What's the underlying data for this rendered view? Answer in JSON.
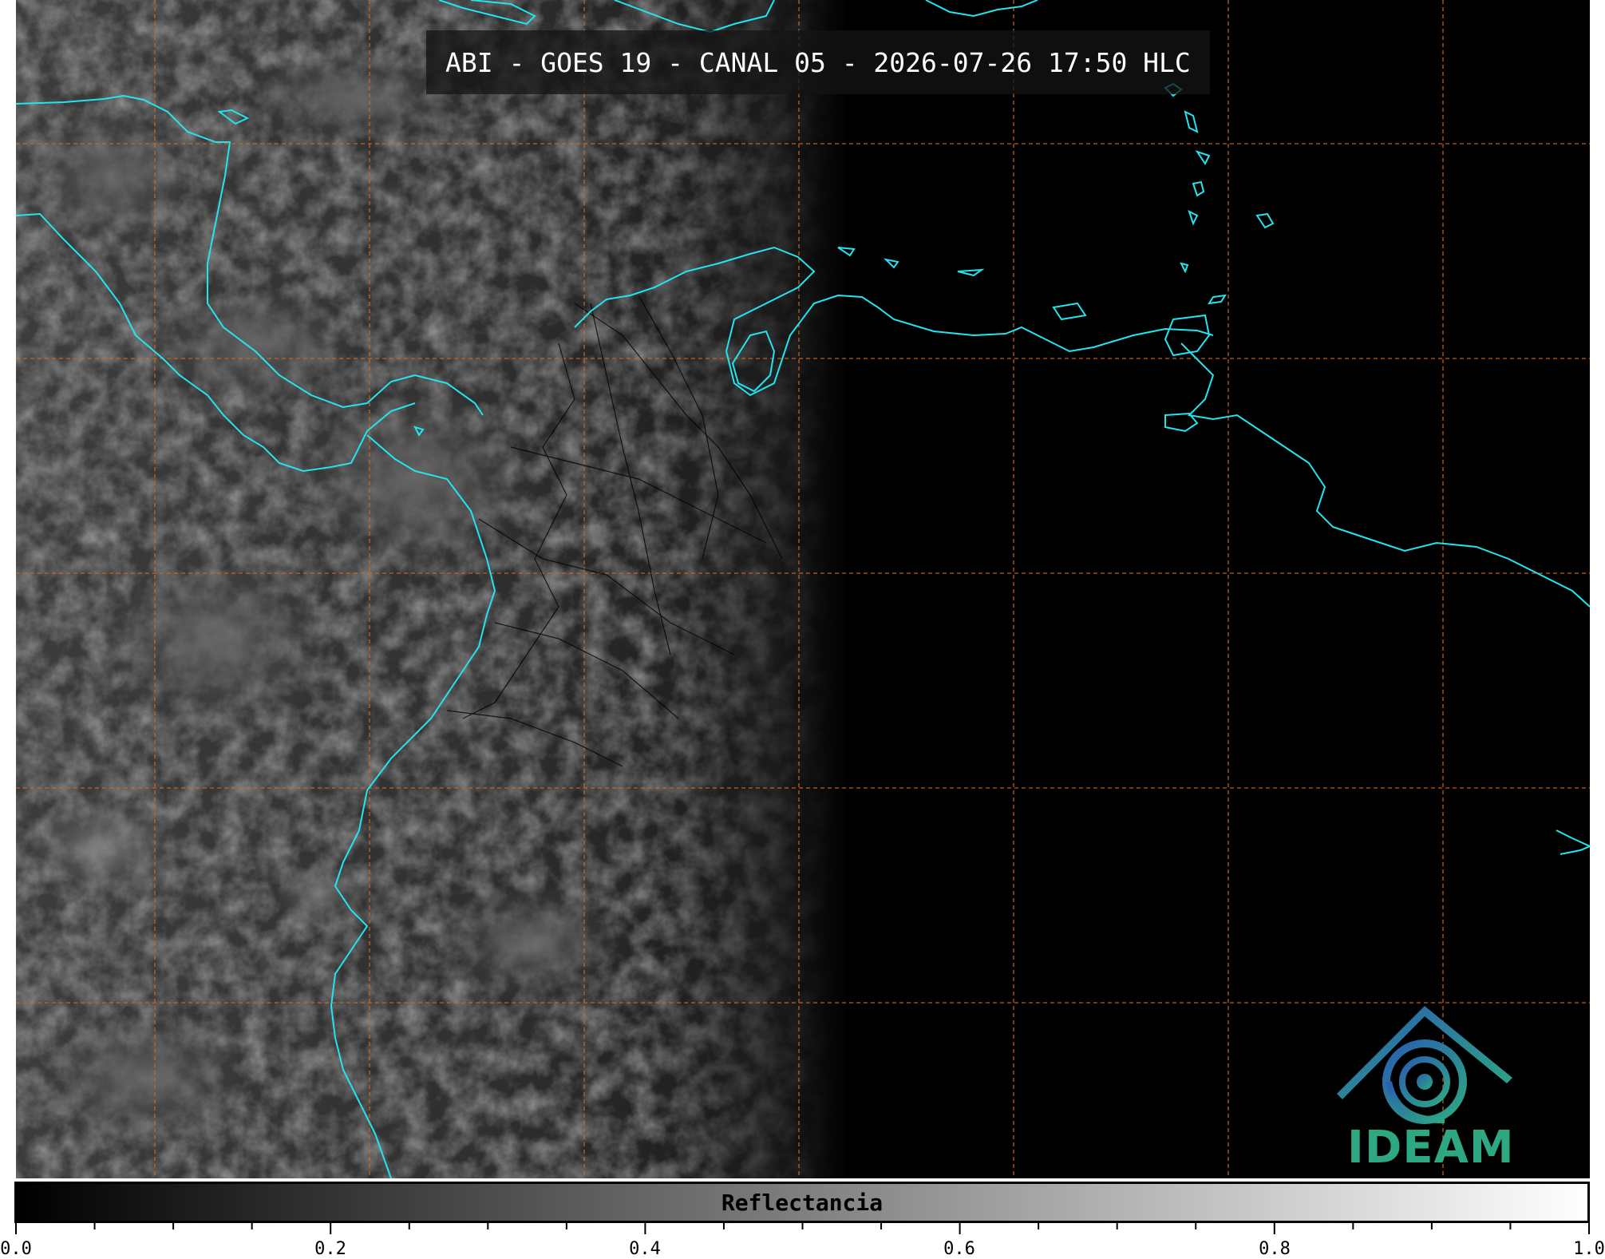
{
  "title": "ABI - GOES 19 - CANAL 05 - 2026-07-26 17:50 HLC",
  "logo_text": "IDEAM",
  "colorbar": {
    "label": "Reflectancia",
    "range": [
      0.0,
      1.0
    ],
    "tick_labels": [
      "0.0",
      "0.2",
      "0.4",
      "0.6",
      "0.8",
      "1.0"
    ],
    "gradient_from": "#000000",
    "gradient_to": "#ffffff"
  },
  "colors": {
    "coastline": "#22e5f0",
    "gridline": "#d2691e",
    "borders": "#000000",
    "logo_blue": "#2a7fb0",
    "logo_green": "#2ea882"
  }
}
